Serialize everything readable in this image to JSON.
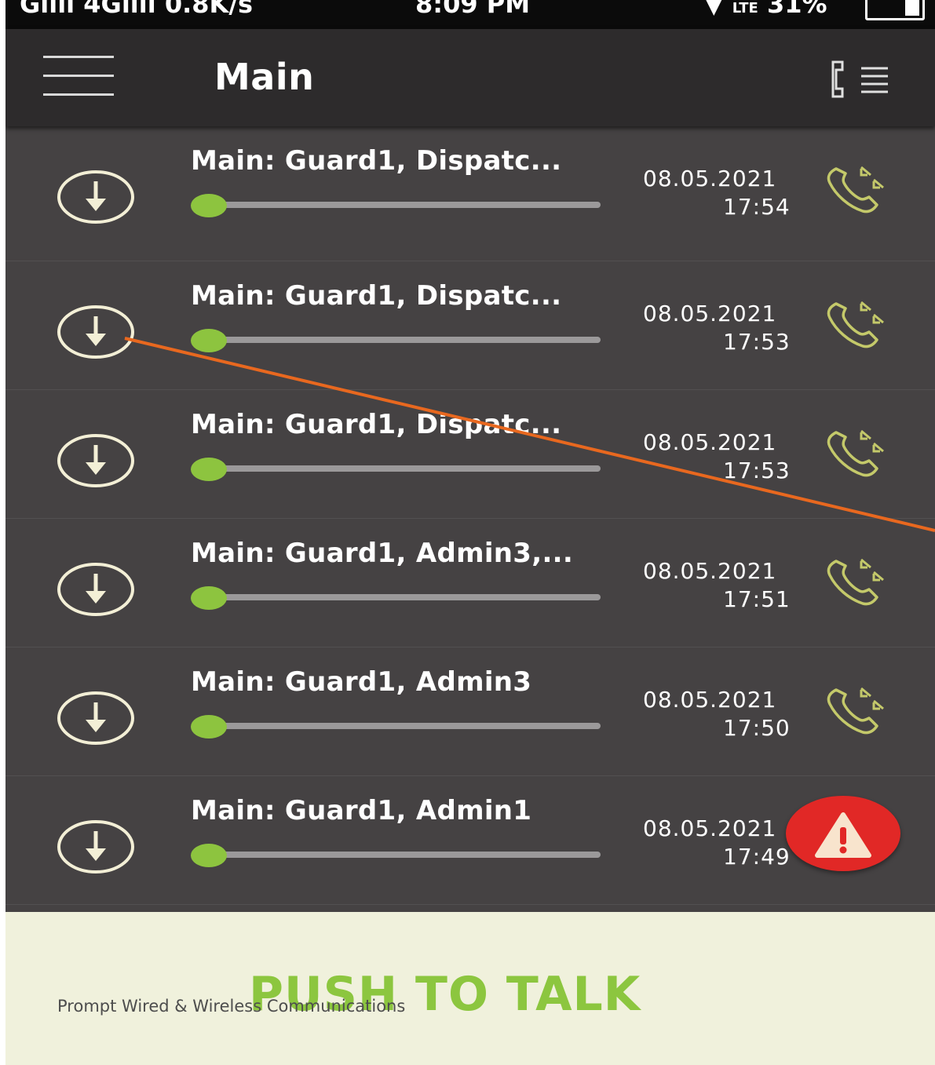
{
  "status_bar": {
    "left_text": "Gıııı 4Gıııı 0.8K/s",
    "time": "8:09 PM",
    "right_text": "LTE",
    "battery": "31%"
  },
  "app_bar": {
    "title": "Main",
    "menu_icon": "hamburger-menu-icon",
    "right_icon": "call-list-icon"
  },
  "calls": [
    {
      "title": "Main: Guard1, Dispatc...",
      "date": "08.05.2021",
      "time": "17:54",
      "progress": 0
    },
    {
      "title": "Main: Guard1, Dispatc...",
      "date": "08.05.2021",
      "time": "17:53",
      "progress": 0
    },
    {
      "title": "Main: Guard1, Dispatc...",
      "date": "08.05.2021",
      "time": "17:53",
      "progress": 0
    },
    {
      "title": "Main: Guard1, Admin3,...",
      "date": "08.05.2021",
      "time": "17:51",
      "progress": 0
    },
    {
      "title": "Main: Guard1, Admin3",
      "date": "08.05.2021",
      "time": "17:50",
      "progress": 0
    },
    {
      "title": "Main: Guard1, Admin1",
      "date": "08.05.2021",
      "time": "17:49",
      "progress": 0
    }
  ],
  "row_icons": {
    "download": "download-circle-icon",
    "incoming_call": "incoming-call-icon"
  },
  "panic_button": {
    "icon": "warning-icon"
  },
  "ptt": {
    "label": "PUSH TO TALK"
  },
  "watermark": "Prompt Wired & Wireless Communications",
  "colors": {
    "list_bg": "#454243",
    "app_bar_bg": "#2d2b2c",
    "accent_green": "#8cc63f",
    "icon_cream": "#f3efd6",
    "call_icon": "#c4c96a",
    "panic_red": "#e12826",
    "ptt_bg": "#f0f1dc",
    "annotation_orange": "#e8681f"
  }
}
